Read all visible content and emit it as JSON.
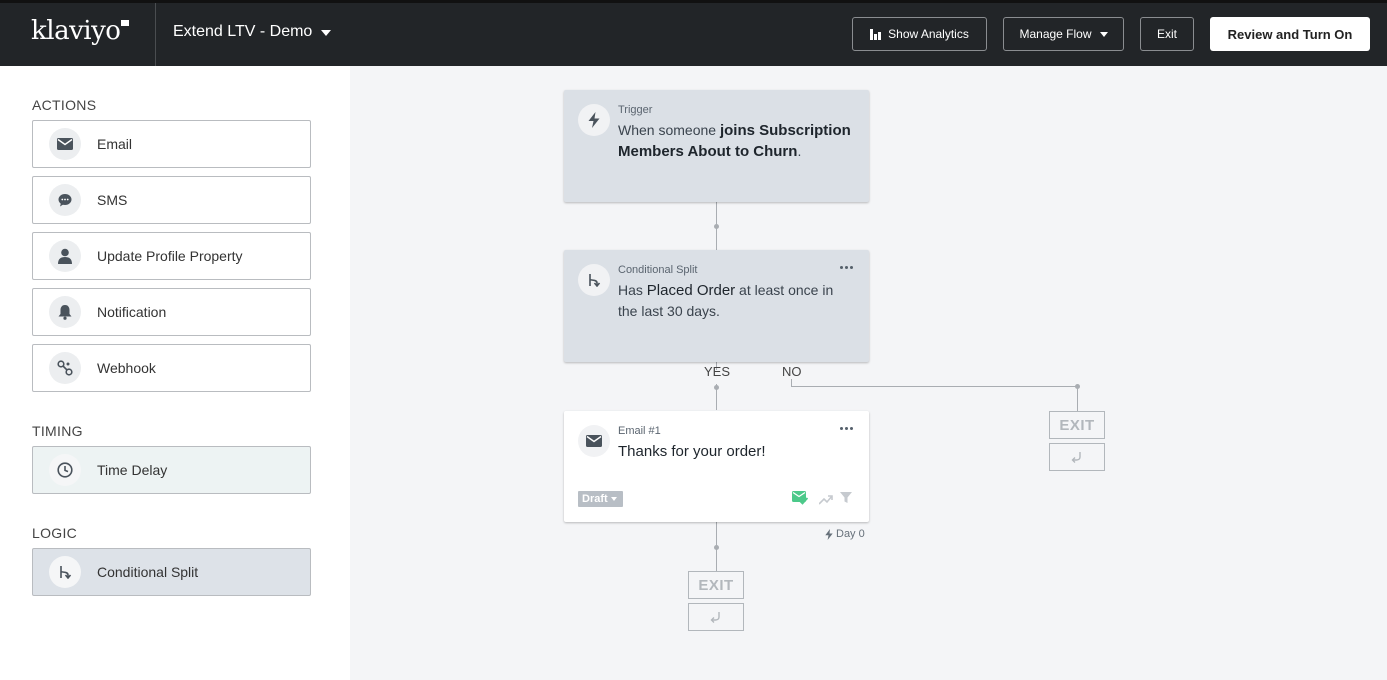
{
  "header": {
    "logo": "klaviyo",
    "flow_name": "Extend LTV - Demo",
    "show_analytics_label": "Show Analytics",
    "manage_flow_label": "Manage Flow",
    "exit_label": "Exit",
    "review_label": "Review and Turn On"
  },
  "sidebar": {
    "actions_title": "ACTIONS",
    "actions": [
      {
        "label": "Email",
        "icon": "envelope-icon"
      },
      {
        "label": "SMS",
        "icon": "chat-bubble-icon"
      },
      {
        "label": "Update Profile Property",
        "icon": "person-icon"
      },
      {
        "label": "Notification",
        "icon": "bell-icon"
      },
      {
        "label": "Webhook",
        "icon": "webhook-icon"
      }
    ],
    "timing_title": "TIMING",
    "timing": [
      {
        "label": "Time Delay",
        "icon": "clock-icon"
      }
    ],
    "logic_title": "LOGIC",
    "logic": [
      {
        "label": "Conditional Split",
        "icon": "split-icon"
      }
    ]
  },
  "canvas": {
    "trigger": {
      "type": "Trigger",
      "text_prefix": "When someone ",
      "text_bold": "joins Subscription Members About to Churn",
      "text_suffix": "."
    },
    "split": {
      "type": "Conditional Split",
      "text_prefix": "Has ",
      "text_emph": "Placed Order",
      "text_suffix": " at least once in the last 30 days.",
      "yes_label": "YES",
      "no_label": "NO"
    },
    "email": {
      "type": "Email #1",
      "subject": "Thanks for your order!",
      "status": "Draft",
      "day_label": "Day 0"
    },
    "exit_label": "EXIT"
  },
  "colors": {
    "topbar": "#222528",
    "card_gray": "#dbe0e6",
    "canvas_bg": "#f4f5f7",
    "check_green": "#4cc98a"
  }
}
